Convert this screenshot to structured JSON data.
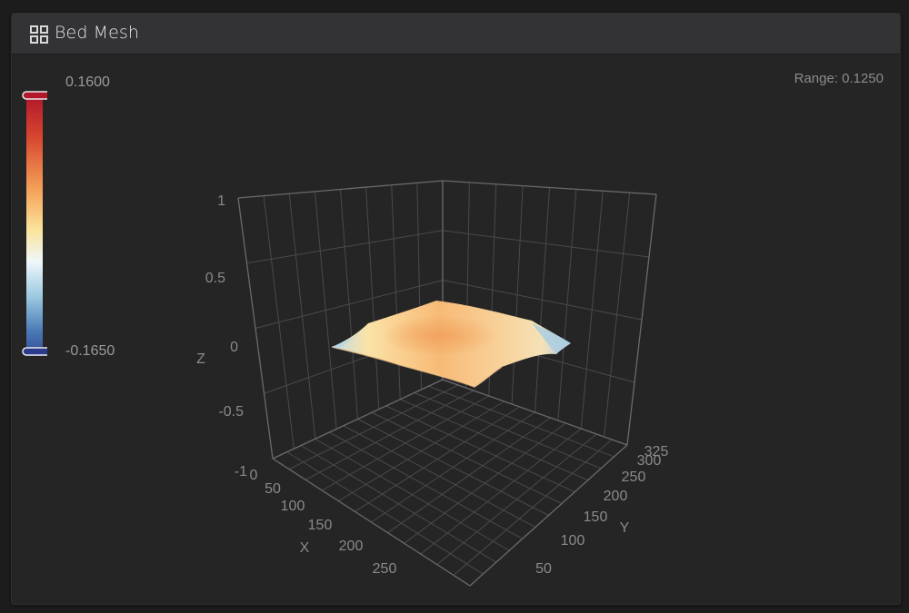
{
  "panel": {
    "title": "Bed Mesh",
    "icon": "grid-icon"
  },
  "range": {
    "text": "Range: 0.1250"
  },
  "colorbar": {
    "max_label": "0.1600",
    "min_label": "-0.1650",
    "colors": [
      "#b2182b",
      "#d6452f",
      "#f4a259",
      "#fbe39a",
      "#eef7fb",
      "#9cc9e0",
      "#4a7ab6",
      "#2b3a8c"
    ]
  },
  "chart_data": {
    "type": "surface",
    "x_axis": {
      "label": "X",
      "ticks": [
        "0",
        "50",
        "100",
        "150",
        "200",
        "250"
      ]
    },
    "y_axis": {
      "label": "Y",
      "ticks": [
        "50",
        "100",
        "150",
        "200",
        "250",
        "300",
        "325"
      ]
    },
    "z_axis": {
      "label": "Z",
      "ticks": [
        "1",
        "0.5",
        "0",
        "-0.5",
        "-1"
      ]
    },
    "zlim": [
      -1,
      1
    ],
    "value_range": [
      -0.165,
      0.16
    ]
  }
}
